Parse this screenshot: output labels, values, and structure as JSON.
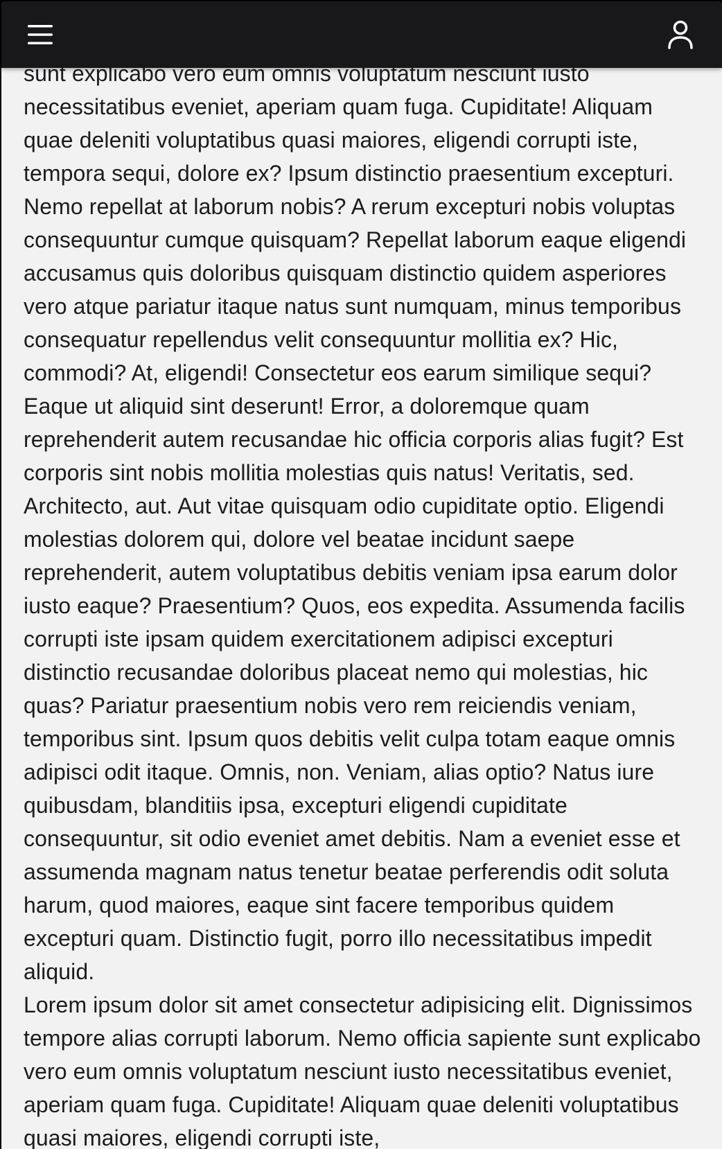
{
  "header": {
    "menu_icon": "hamburger-menu-icon",
    "user_icon": "user-profile-icon",
    "background": "#18181b",
    "icon_color": "#ffffff"
  },
  "content": {
    "paragraphs": [
      "sunt explicabo vero eum omnis voluptatum nesciunt iusto necessitatibus eveniet, aperiam quam fuga. Cupiditate! Aliquam quae deleniti voluptatibus quasi maiores, eligendi corrupti iste, tempora sequi, dolore ex? Ipsum distinctio praesentium excepturi. Nemo repellat at laborum nobis? A rerum excepturi nobis voluptas consequuntur cumque quisquam? Repellat laborum eaque eligendi accusamus quis doloribus quisquam distinctio quidem asperiores vero atque pariatur itaque natus sunt numquam, minus temporibus consequatur repellendus velit consequuntur mollitia ex? Hic, commodi? At, eligendi! Consectetur eos earum similique sequi? Eaque ut aliquid sint deserunt! Error, a doloremque quam reprehenderit autem recusandae hic officia corporis alias fugit? Est corporis sint nobis mollitia molestias quis natus! Veritatis, sed. Architecto, aut. Aut vitae quisquam odio cupiditate optio. Eligendi molestias dolorem qui, dolore vel beatae incidunt saepe reprehenderit, autem voluptatibus debitis veniam ipsa earum dolor iusto eaque? Praesentium? Quos, eos expedita. Assumenda facilis corrupti iste ipsam quidem exercitationem adipisci excepturi distinctio recusandae doloribus placeat nemo qui molestias, hic quas? Pariatur praesentium nobis vero rem reiciendis veniam, temporibus sint. Ipsum quos debitis velit culpa totam eaque omnis adipisci odit itaque. Omnis, non. Veniam, alias optio? Natus iure quibusdam, blanditiis ipsa, excepturi eligendi cupiditate consequuntur, sit odio eveniet amet debitis. Nam a eveniet esse et assumenda magnam natus tenetur beatae perferendis odit soluta harum, quod maiores, eaque sint facere temporibus quidem excepturi quam. Distinctio fugit, porro illo necessitatibus impedit aliquid.",
      "Lorem ipsum dolor sit amet consectetur adipisicing elit. Dignissimos tempore alias corrupti laborum. Nemo officia sapiente sunt explicabo vero eum omnis voluptatum nesciunt iusto necessitatibus eveniet, aperiam quam fuga. Cupiditate! Aliquam quae deleniti voluptatibus quasi maiores, eligendi corrupti iste,"
    ]
  }
}
